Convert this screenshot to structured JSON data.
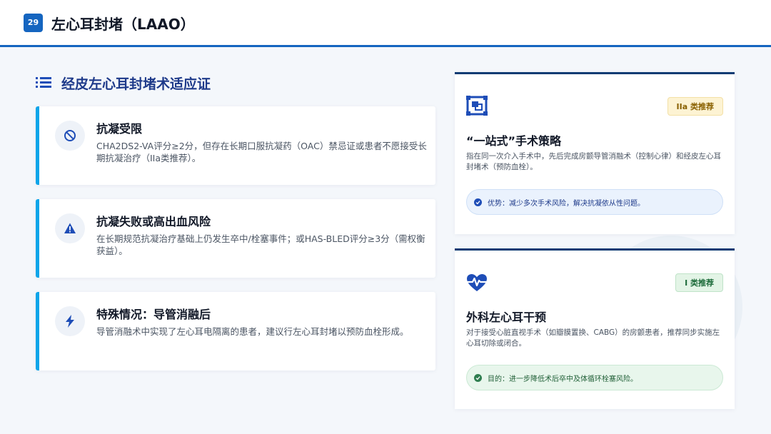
{
  "header": {
    "page_number": "29",
    "title": "左心耳封堵（LAAO）"
  },
  "section": {
    "title": "经皮左心耳封堵术适应证",
    "icon": "list-icon"
  },
  "indications": [
    {
      "icon": "ban-icon",
      "title": "抗凝受限",
      "body": "CHA2DS2-VA评分≥2分，但存在长期口服抗凝药（OAC）禁忌证或患者不愿接受长期抗凝治疗（IIa类推荐）。"
    },
    {
      "icon": "warning-icon",
      "title": "抗凝失败或高出血风险",
      "body": "在长期规范抗凝治疗基础上仍发生卒中/栓塞事件；或HAS-BLED评分≥3分（需权衡获益）。"
    },
    {
      "icon": "bolt-icon",
      "title": "特殊情况：导管消融后",
      "body": "导管消融术中实现了左心耳电隔离的患者，建议行左心耳封堵以预防血栓形成。"
    }
  ],
  "strategies": [
    {
      "icon": "one-stop-icon",
      "badge": "IIa 类推荐",
      "title": "“一站式”手术策略",
      "body": "指在同一次介入手术中，先后完成房颤导管消融术（控制心律）和经皮左心耳封堵术（预防血栓）。",
      "note": "优势：减少多次手术风险，解决抗凝依从性问题。"
    },
    {
      "icon": "heartbeat-icon",
      "badge": "I 类推荐",
      "title": "外科左心耳干预",
      "body": "对于接受心脏直视手术（如瓣膜置换、CABG）的房颤患者，推荐同步实施左心耳切除或闭合。",
      "note": "目的：进一步降低术后卒中及体循环栓塞风险。"
    }
  ],
  "colors": {
    "accent": "#1565c0",
    "card_border": "#0ea5e9",
    "right_card_top": "#0d3b73",
    "badge_iia_bg": "#fdf3d3",
    "badge_i_bg": "#e3f4e6"
  }
}
